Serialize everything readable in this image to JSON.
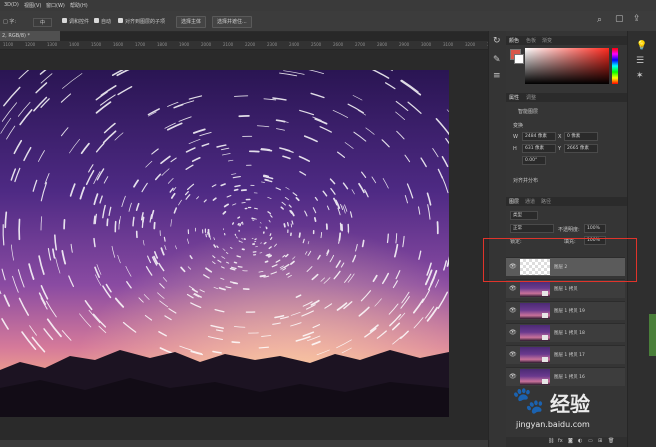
{
  "menubar": {
    "items": [
      "3D(D)",
      "视图(V)",
      "窗口(W)",
      "帮助(H)"
    ]
  },
  "options": {
    "mode_label": "□ 字:",
    "mode_value": "中",
    "auto_layer_label": "调和控件",
    "align_label": "自动",
    "checkbox3_label": "对齐到图层的子项",
    "btn_select_subject": "选择主体",
    "btn_select_refine": "选择并遮住..."
  },
  "document": {
    "tab_label": "2, RGB/8) *"
  },
  "ruler": {
    "ticks": [
      "1100",
      "1200",
      "1300",
      "1400",
      "1500",
      "1600",
      "1700",
      "1800",
      "1900",
      "2000",
      "2100",
      "2200",
      "2300",
      "2400",
      "2500",
      "2600",
      "2700",
      "2800",
      "2900",
      "3000",
      "3100",
      "3200",
      "3300",
      "3400",
      "3500",
      "3600",
      "3700",
      "3800",
      "3900",
      "4000",
      "4100",
      "4200",
      "4300",
      "4400",
      "4500",
      "4600"
    ]
  },
  "color_panel": {
    "tabs": [
      "颜色",
      "色板",
      "渐变"
    ],
    "fg_color": "#d9574a"
  },
  "properties_panel": {
    "tabs": [
      "属性",
      "调整"
    ],
    "subtitle": "智能图层",
    "section_transform": "变换",
    "w_value": "2484 像素",
    "x_value": "0 像素",
    "h_value": "631 像素",
    "y_value": "2665 像素",
    "angle_value": "0.00°",
    "section_align": "对齐并分布"
  },
  "layers_panel": {
    "tabs": [
      "图层",
      "通道",
      "路径"
    ],
    "filter_label": "类型",
    "blend_mode": "正常",
    "opacity_label": "不透明度:",
    "opacity_value": "100%",
    "lock_label": "锁定:",
    "fill_label": "填充:",
    "fill_value": "100%",
    "layers": [
      {
        "name": "图层 2",
        "selected": true,
        "empty": true
      },
      {
        "name": "图层 1 拷贝"
      },
      {
        "name": "图层 1 拷贝 19"
      },
      {
        "name": "图层 1 拷贝 18"
      },
      {
        "name": "图层 1 拷贝 17"
      },
      {
        "name": "图层 1 拷贝 16"
      }
    ]
  },
  "watermark": {
    "text": "经验",
    "url": "jingyan.baidu.com"
  },
  "icons": {
    "search": "search-icon",
    "lightbulb": "lightbulb-icon"
  }
}
